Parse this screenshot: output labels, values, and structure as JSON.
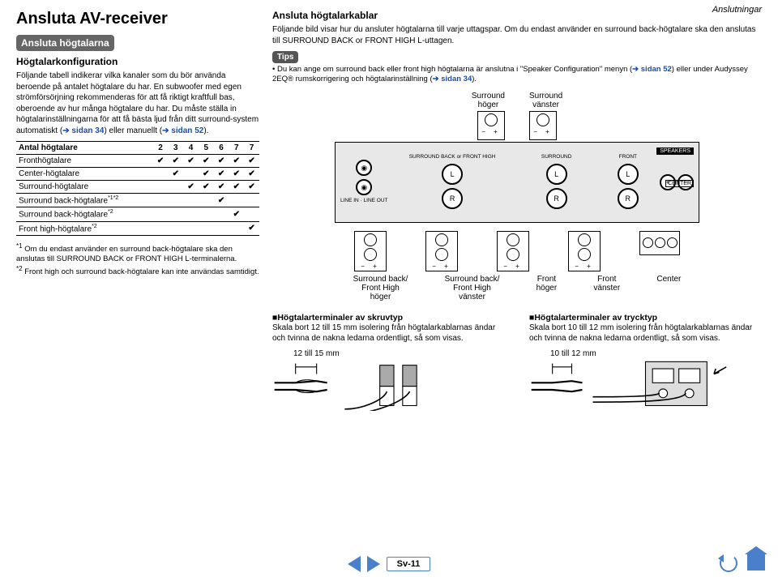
{
  "header_category": "Anslutningar",
  "title": "Ansluta AV-receiver",
  "section_box": "Ansluta högtalarna",
  "sub_heading": "Högtalarkonfiguration",
  "intro_para": "Följande tabell indikerar vilka kanaler som du bör använda beroende på antalet högtalare du har.\nEn subwoofer med egen strömförsörjning rekommenderas för att få riktigt kraftfull bas, oberoende av hur många högtalare du har.\nDu måste ställa in högtalarinställningarna för att få bästa ljud från ditt surround-system automatiskt (",
  "intro_link1": "➔ sidan 34",
  "intro_mid": ") eller manuellt (",
  "intro_link2": "➔ sidan 52",
  "intro_end": ").",
  "table": {
    "header_label": "Antal högtalare",
    "cols": [
      "2",
      "3",
      "4",
      "5",
      "6",
      "7",
      "7"
    ],
    "rows": [
      {
        "label": "Fronthögtalare",
        "cells": [
          "✔",
          "✔",
          "✔",
          "✔",
          "✔",
          "✔",
          "✔"
        ]
      },
      {
        "label": "Center-högtalare",
        "cells": [
          "",
          "✔",
          "",
          "✔",
          "✔",
          "✔",
          "✔"
        ]
      },
      {
        "label": "Surround-högtalare",
        "cells": [
          "",
          "",
          "✔",
          "✔",
          "✔",
          "✔",
          "✔"
        ]
      },
      {
        "label": "Surround back-högtalare*1*2",
        "cells": [
          "",
          "",
          "",
          "",
          "✔",
          "",
          ""
        ]
      },
      {
        "label": "Surround back-högtalare*2",
        "cells": [
          "",
          "",
          "",
          "",
          "",
          "✔",
          ""
        ]
      },
      {
        "label": "Front high-högtalare*2",
        "cells": [
          "",
          "",
          "",
          "",
          "",
          "",
          "✔"
        ]
      }
    ]
  },
  "footnotes": [
    {
      "num": "*1",
      "text": "Om du endast använder en surround back-högtalare ska den anslutas till SURROUND BACK or FRONT HIGH L-terminalerna."
    },
    {
      "num": "*2",
      "text": "Front high och surround back-högtalare kan inte användas samtidigt."
    }
  ],
  "right_heading": "Ansluta högtalarkablar",
  "right_para": "Följande bild visar hur du ansluter högtalarna till varje uttagspar. Om du endast använder en surround back-högtalare ska den anslutas till SURROUND BACK or FRONT HIGH L-uttagen.",
  "tips_label": "Tips",
  "tips_bullet": "Du kan ange om surround back eller front high högtalarna är anslutna i \"Speaker Configuration\" menyn (",
  "tips_link1": "➔ sidan 52",
  "tips_mid": ") eller under Audyssey 2EQ® rumskorrigering och högtalarinställning (",
  "tips_link2": "➔ sidan 34",
  "tips_end": ").",
  "toplabels": [
    "Surround\nhöger",
    "Surround\nvänster"
  ],
  "panel_columns": [
    {
      "section": "SURROUND BACK or FRONT HIGH",
      "top": "L",
      "bot": "R"
    },
    {
      "section": "SURROUND",
      "top": "L",
      "bot": "R"
    },
    {
      "section": "FRONT",
      "top": "L",
      "bot": "R"
    }
  ],
  "badges": {
    "speakers": "SPEAKERS",
    "center": "CENTER"
  },
  "spk_labels_below": [
    "Surround back/\nFront High\nhöger",
    "Surround back/\nFront High\nvänster",
    "Front\nhöger",
    "Front\nvänster",
    "Center"
  ],
  "bottom": {
    "left": {
      "heading": "■Högtalarterminaler av skruvtyp",
      "text": "Skala bort 12 till 15 mm isolering från högtalarkablarnas ändar och tvinna de nakna ledarna ordentligt, så som visas.",
      "dim": "12 till 15 mm"
    },
    "right": {
      "heading": "■Högtalarterminaler av trycktyp",
      "text": "Skala bort 10 till 12 mm isolering från högtalarkablarnas ändar och tvinna de nakna ledarna ordentligt, så som visas.",
      "dim": "10 till 12 mm"
    }
  },
  "pageno": "Sv-11"
}
